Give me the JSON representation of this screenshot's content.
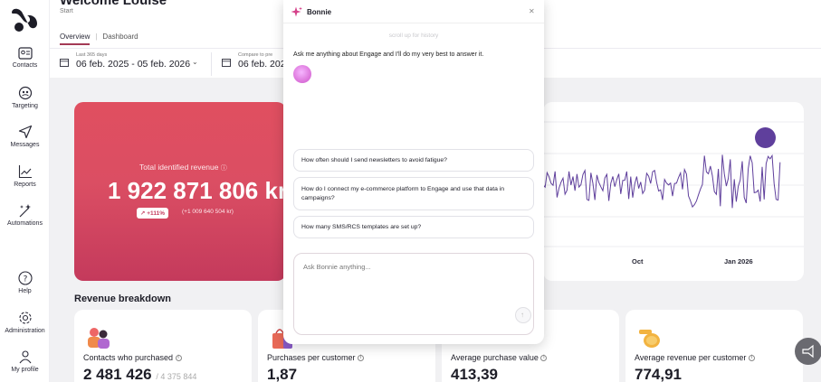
{
  "header": {
    "welcome": "Welcome Louise",
    "breadcrumb": "Start",
    "tabs": [
      "Overview",
      "Dashboard"
    ],
    "period_label": "Last 365 days",
    "period_value": "06 feb. 2025 - 05 feb. 2026",
    "compare_label": "Compare to pre",
    "compare_value": "06 feb. 202"
  },
  "sidebar": {
    "items": [
      {
        "label": "Contacts",
        "icon": "contacts-icon"
      },
      {
        "label": "Targeting",
        "icon": "targeting-icon"
      },
      {
        "label": "Messages",
        "icon": "send-icon"
      },
      {
        "label": "Reports",
        "icon": "chart-icon"
      },
      {
        "label": "Automations",
        "icon": "sparkle-icon"
      },
      {
        "label": "Help",
        "icon": "help-icon"
      },
      {
        "label": "Administration",
        "icon": "gear-icon"
      },
      {
        "label": "My profile",
        "icon": "user-icon"
      }
    ]
  },
  "revenue": {
    "label": "Total identified revenue",
    "value": "1 922 871 806 kr",
    "change_pct": "+111%",
    "change_abs": "(+1 009 640 504 kr)"
  },
  "chart": {
    "x_labels": [
      "Oct",
      "Jan 2026"
    ],
    "series_color": "#5f3f9c"
  },
  "breakdown": {
    "title": "Revenue breakdown",
    "kpis": [
      {
        "label": "Contacts who purchased",
        "value": "2 481 426",
        "sub": "/ 4 375 844"
      },
      {
        "label": "Purchases per customer",
        "value": "1,87"
      },
      {
        "label": "Average purchase value",
        "value": "413,39"
      },
      {
        "label": "Average revenue per customer",
        "value": "774,91"
      }
    ]
  },
  "chat": {
    "title": "Bonnie",
    "history_hint": "scroll up for history",
    "greeting": "Ask me anything about Engage and I'll do my very best to answer it.",
    "suggestions": [
      "How often should I send newsletters to avoid fatigue?",
      "How do I connect my e-commerce platform to Engage and use that data in campaigns?",
      "How many SMS/RCS templates are set up?"
    ],
    "input_placeholder": "Ask Bonnie anything..."
  },
  "colors": {
    "accent": "#a33a55",
    "revenue_card": "#db4e63",
    "chart_line": "#5f3f9c"
  }
}
